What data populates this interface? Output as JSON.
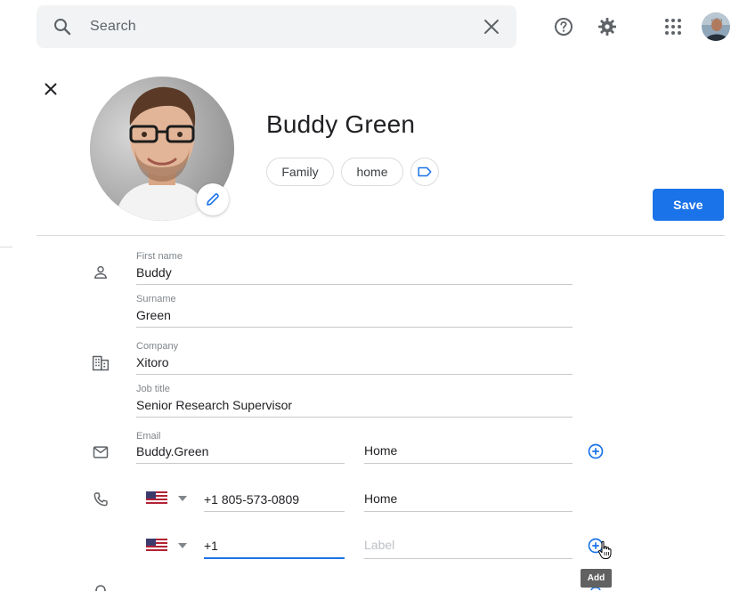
{
  "search": {
    "placeholder": "Search"
  },
  "contact": {
    "name": "Buddy Green",
    "labels": [
      "Family",
      "home"
    ],
    "save_label": "Save"
  },
  "fields": {
    "first_name": {
      "label": "First name",
      "value": "Buddy"
    },
    "surname": {
      "label": "Surname",
      "value": "Green"
    },
    "company": {
      "label": "Company",
      "value": "Xitoro"
    },
    "job_title": {
      "label": "Job title",
      "value": "Senior Research Supervisor"
    },
    "email": {
      "label": "Email",
      "value": "Buddy.Green",
      "type": "Home"
    },
    "phone1": {
      "country": "US",
      "value": "+1 805-573-0809",
      "type": "Home"
    },
    "phone2": {
      "country": "US",
      "value": "+1",
      "type_placeholder": "Label"
    }
  },
  "tooltip": {
    "add": "Add"
  },
  "colors": {
    "accent": "#1a73e8",
    "icon": "#5f6368"
  }
}
